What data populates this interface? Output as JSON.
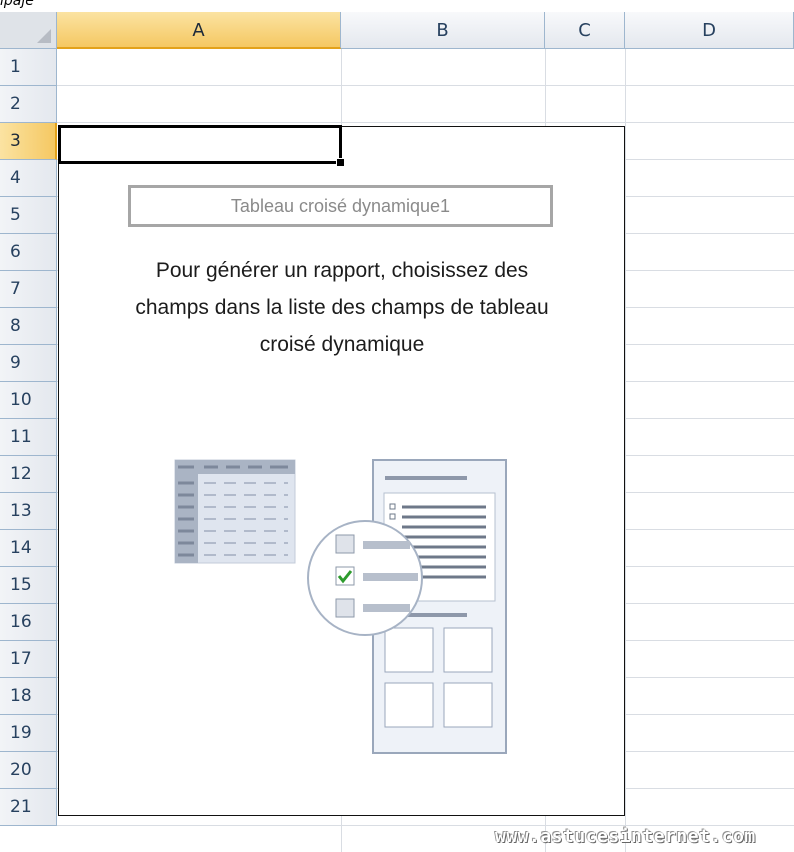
{
  "top_strip_text": "ipaje",
  "columns": [
    {
      "label": "A",
      "selected": true
    },
    {
      "label": "B",
      "selected": false
    },
    {
      "label": "C",
      "selected": false
    },
    {
      "label": "D",
      "selected": false
    }
  ],
  "rows": [
    "1",
    "2",
    "3",
    "4",
    "5",
    "6",
    "7",
    "8",
    "9",
    "10",
    "11",
    "12",
    "13",
    "14",
    "15",
    "16",
    "17",
    "18",
    "19",
    "20",
    "21"
  ],
  "selected_row": "3",
  "pivot": {
    "title": "Tableau croisé dynamique1",
    "message_lines": [
      "Pour générer un rapport, choisissez des",
      "champs dans la liste des champs de tableau",
      "croisé dynamique"
    ]
  },
  "watermark": "www.astucesinternet.com",
  "colors": {
    "selected_header": "#f5c862",
    "header_text": "#27415f",
    "grid": "#d9dde3"
  }
}
